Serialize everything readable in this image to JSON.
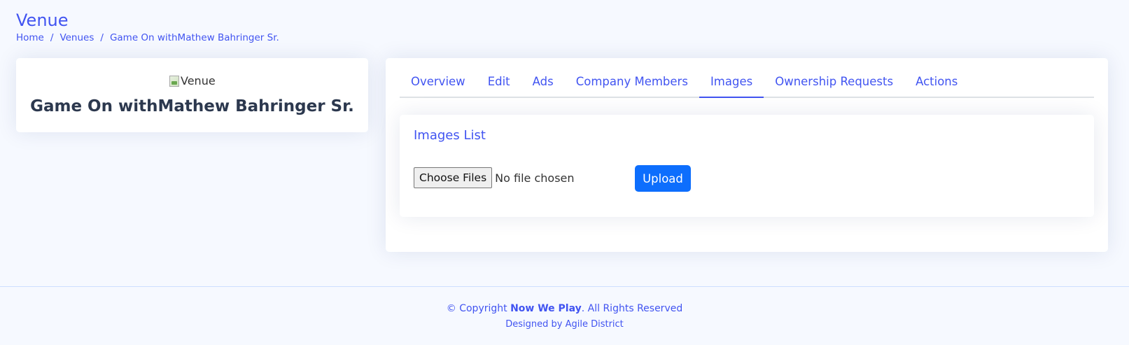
{
  "page": {
    "title": "Venue"
  },
  "breadcrumb": {
    "items": [
      "Home",
      "Venues",
      "Game On withMathew Bahringer Sr."
    ],
    "separator": "/"
  },
  "profile": {
    "image_alt": "Venue",
    "name": "Game On withMathew Bahringer Sr."
  },
  "tabs": {
    "items": [
      "Overview",
      "Edit",
      "Ads",
      "Company Members",
      "Images",
      "Ownership Requests",
      "Actions"
    ],
    "active": "Images"
  },
  "images": {
    "title": "Images List",
    "choose_label": "Choose Files",
    "no_file_text": "No file chosen",
    "upload_label": "Upload"
  },
  "footer": {
    "copyright_prefix": "© Copyright ",
    "brand": "Now We Play",
    "copyright_suffix": ". All Rights Reserved",
    "designed_prefix": "Designed by ",
    "designer": "Agile District"
  },
  "colors": {
    "accent": "#4154f1",
    "primary_button": "#0d6efd",
    "background": "#f6f9ff",
    "heading": "#2c384e"
  }
}
